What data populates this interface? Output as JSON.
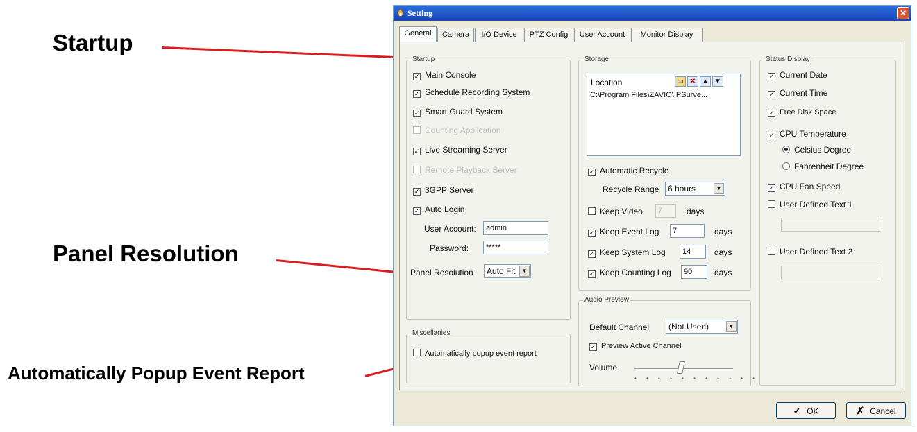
{
  "callouts": {
    "startup": "Startup",
    "panel_resolution": "Panel Resolution",
    "popup_event_report": "Automatically Popup Event Report"
  },
  "window": {
    "title": "Setting",
    "close_glyph": "✕",
    "icon": "setting-icon"
  },
  "tabs": [
    "General",
    "Camera",
    "I/O Device",
    "PTZ Config",
    "User Account",
    "Monitor Display"
  ],
  "active_tab": "General",
  "startup": {
    "label": "Startup",
    "items": [
      {
        "label": "Main Console",
        "checked": true
      },
      {
        "label": "Schedule Recording System",
        "checked": true
      },
      {
        "label": "Smart Guard System",
        "checked": true
      },
      {
        "label": "Counting Application",
        "checked": false,
        "disabled": true
      },
      {
        "label": "Live Streaming Server",
        "checked": true
      },
      {
        "label": "Remote Playback Server",
        "checked": false,
        "disabled": true
      },
      {
        "label": "3GPP Server",
        "checked": true
      },
      {
        "label": "Auto Login",
        "checked": true
      }
    ],
    "user_account_label": "User Account:",
    "user_account_value": "admin",
    "password_label": "Password:",
    "password_value": "*****",
    "panel_resolution_label": "Panel Resolution",
    "panel_resolution_value": "Auto Fit"
  },
  "misc": {
    "label": "Miscellanies",
    "popup_label": "Automatically popup event report",
    "popup_checked": false
  },
  "storage": {
    "label": "Storage",
    "location_label": "Location",
    "location_path": "C:\\Program Files\\ZAVIO\\IPSurve...",
    "toolbar_icons": [
      "folder-icon",
      "delete-icon",
      "up-icon",
      "down-icon"
    ],
    "automatic_recycle_label": "Automatic Recycle",
    "automatic_recycle_checked": true,
    "recycle_range_label": "Recycle Range",
    "recycle_range_value": "6 hours",
    "keep_video_label": "Keep Video",
    "keep_video_checked": false,
    "keep_video_value": "7",
    "keep_event_log_label": "Keep Event Log",
    "keep_event_log_checked": true,
    "keep_event_log_value": "7",
    "keep_system_log_label": "Keep System Log",
    "keep_system_log_checked": true,
    "keep_system_log_value": "14",
    "keep_counting_log_label": "Keep Counting Log",
    "keep_counting_log_checked": true,
    "keep_counting_log_value": "90",
    "days_label": "days"
  },
  "audio": {
    "label": "Audio Preview",
    "default_channel_label": "Default Channel",
    "default_channel_value": "(Not Used)",
    "preview_active_label": "Preview Active Channel",
    "preview_active_checked": true,
    "volume_label": "Volume",
    "volume_level": 0.45
  },
  "status": {
    "label": "Status Display",
    "current_date": "Current Date",
    "current_time": "Current Time",
    "free_disk_space": "Free Disk Space",
    "cpu_temperature": "CPU Temperature",
    "celsius": "Celsius Degree",
    "fahrenheit": "Fahrenheit Degree",
    "temperature_unit": "Celsius",
    "cpu_fan_speed": "CPU Fan Speed",
    "user_text_1": "User Defined Text 1",
    "user_text_2": "User Defined Text 2"
  },
  "buttons": {
    "ok_label": "OK",
    "cancel_label": "Cancel"
  },
  "colors": {
    "callout_line": "#d81e1e",
    "titlebar": "#1f5cc9"
  }
}
